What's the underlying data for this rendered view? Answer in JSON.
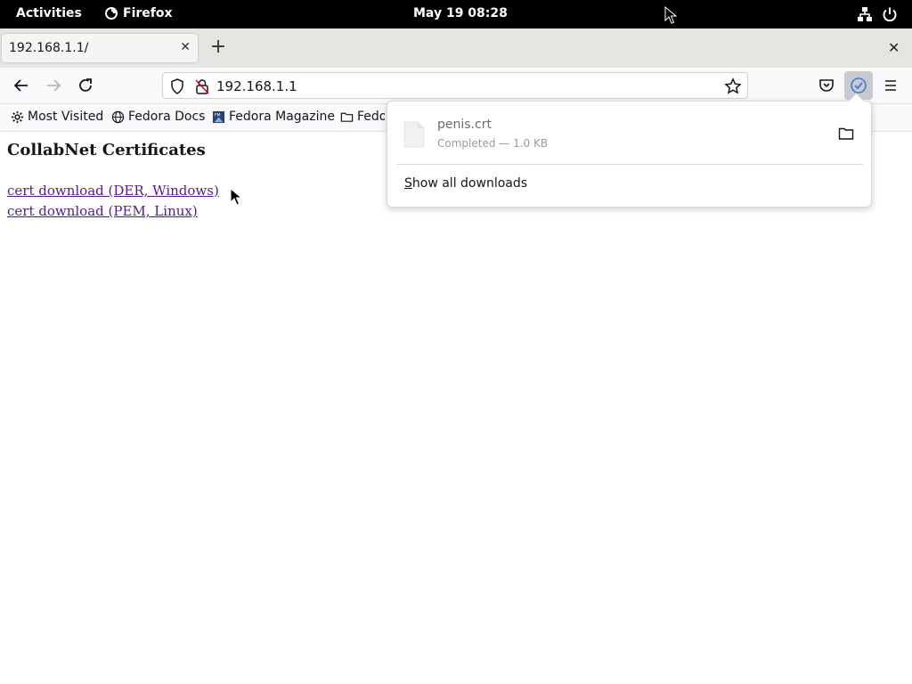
{
  "system_bar": {
    "activities": "Activities",
    "app_name": "Firefox",
    "clock": "May 19  08:28",
    "icons": [
      "network-icon",
      "power-icon"
    ]
  },
  "tabs": [
    {
      "title": "192.168.1.1/",
      "active": true
    }
  ],
  "navbar": {
    "url": "192.168.1.1",
    "icons": [
      "back-icon",
      "forward-icon",
      "reload-icon",
      "shield-icon",
      "insecure-lock-icon",
      "bookmark-star-icon",
      "pocket-icon",
      "downloads-icon",
      "menu-icon"
    ]
  },
  "bookmarks": [
    {
      "label": "Most Visited",
      "icon": "gear-icon"
    },
    {
      "label": "Fedora Docs",
      "icon": "globe-icon"
    },
    {
      "label": "Fedora Magazine",
      "icon": "fm-icon"
    },
    {
      "label": "Fedo",
      "icon": "folder-icon"
    }
  ],
  "page": {
    "heading": "CollabNet Certificates",
    "links": [
      "cert download (DER, Windows)",
      "cert download (PEM, Linux)"
    ]
  },
  "downloads_panel": {
    "items": [
      {
        "file_name": "penis.crt",
        "status": "Completed — 1.0 KB"
      }
    ],
    "show_all_label": "Show all downloads",
    "show_all_accesskey": "S",
    "show_all_rest": "how all downloads"
  },
  "colors": {
    "system_bar_bg": "#000000",
    "tab_strip_bg": "#e7e5e2",
    "visited_link": "#551a8b",
    "downloads_accent": "#3a7bd5"
  }
}
